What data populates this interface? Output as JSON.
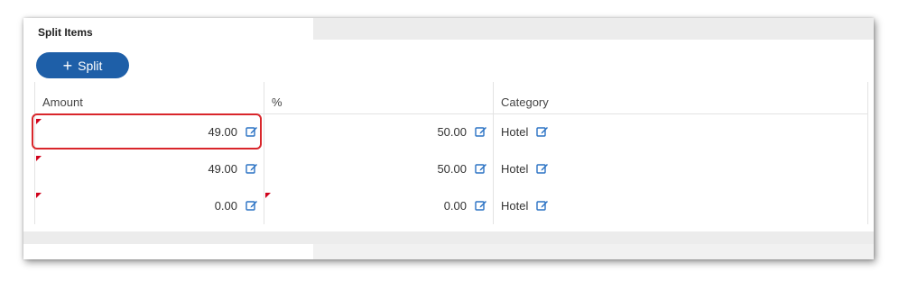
{
  "panel": {
    "tab_title": "Split Items"
  },
  "toolbar": {
    "split_label": "Split",
    "split_icon": "+"
  },
  "table": {
    "headers": [
      "Amount",
      "%",
      "Category"
    ],
    "rows": [
      {
        "amount": "49.00",
        "percent": "50.00",
        "category": "Hotel"
      },
      {
        "amount": "49.00",
        "percent": "50.00",
        "category": "Hotel"
      },
      {
        "amount": "0.00",
        "percent": "0.00",
        "category": "Hotel"
      }
    ]
  },
  "colors": {
    "button": "#1e5fa8",
    "edit_icon": "#2a72c4",
    "flag": "#d0021b",
    "highlight": "#d9262b"
  }
}
